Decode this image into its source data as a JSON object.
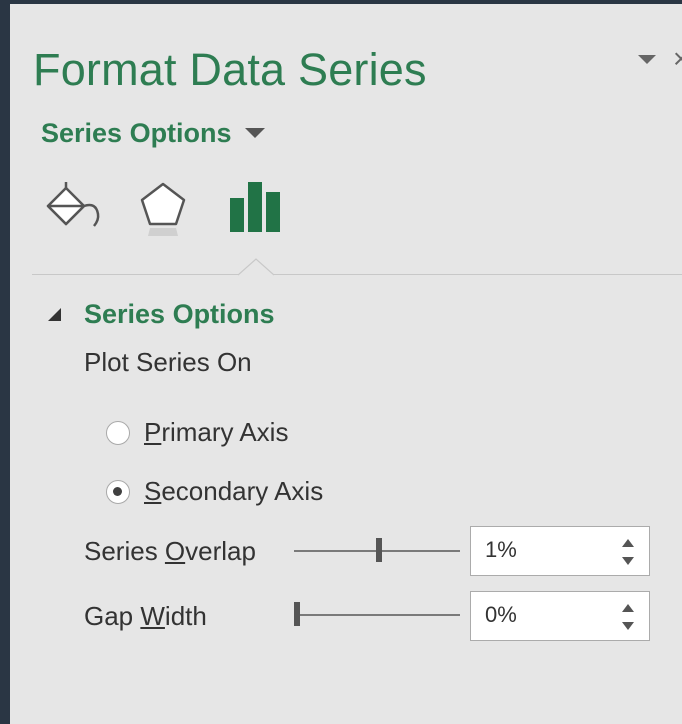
{
  "pane": {
    "title": "Format Data Series",
    "options_menu_label": "Series Options"
  },
  "category_tabs": [
    {
      "icon": "paint-bucket-icon",
      "selected": false
    },
    {
      "icon": "pentagon-shape-icon",
      "selected": false
    },
    {
      "icon": "bar-chart-icon",
      "selected": true
    }
  ],
  "section": {
    "title": "Series Options",
    "plot_series_on_label": "Plot Series On",
    "radios": [
      {
        "label_accesskey": "P",
        "label_rest": "rimary Axis",
        "checked": false
      },
      {
        "label_accesskey": "S",
        "label_rest": "econdary Axis",
        "checked": true
      }
    ],
    "overlap": {
      "label_prefix": "Series ",
      "label_accesskey": "O",
      "label_rest": "verlap",
      "value": "1%",
      "level": 0.51
    },
    "gap": {
      "label_prefix": "Gap ",
      "label_accesskey": "W",
      "label_rest": "idth",
      "value": "0%",
      "level": 0.0
    }
  },
  "colors": {
    "accent": "#2e7d52",
    "pane_bg": "#e6e6e6",
    "outer_bg": "#2a3644"
  }
}
